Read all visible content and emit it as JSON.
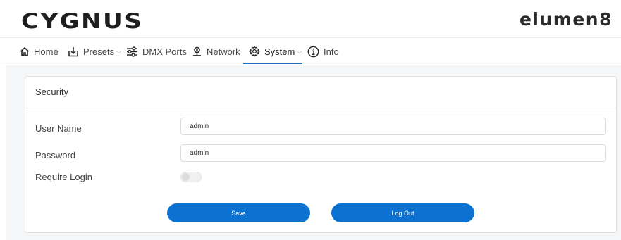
{
  "header": {
    "brand_left": "CYGNUS",
    "brand_right": "elumen8"
  },
  "nav": {
    "items": [
      {
        "label": "Home",
        "icon": "home-icon"
      },
      {
        "label": "Presets",
        "icon": "download-tray-icon",
        "dropdown": true
      },
      {
        "label": "DMX Ports",
        "icon": "sliders-icon"
      },
      {
        "label": "Network",
        "icon": "network-node-icon"
      },
      {
        "label": "System",
        "icon": "gear-icon",
        "dropdown": true,
        "active": true
      },
      {
        "label": "Info",
        "icon": "info-icon"
      }
    ],
    "chevron": "⌵"
  },
  "security": {
    "title": "Security",
    "username_label": "User Name",
    "username_value": "admin",
    "password_label": "Password",
    "password_value": "admin",
    "require_login_label": "Require Login",
    "require_login_enabled": false,
    "save_label": "Save",
    "logout_label": "Log Out"
  },
  "colors": {
    "accent": "#0b72d2",
    "active_underline": "#1f73c6",
    "background": "#f5f6f7"
  }
}
